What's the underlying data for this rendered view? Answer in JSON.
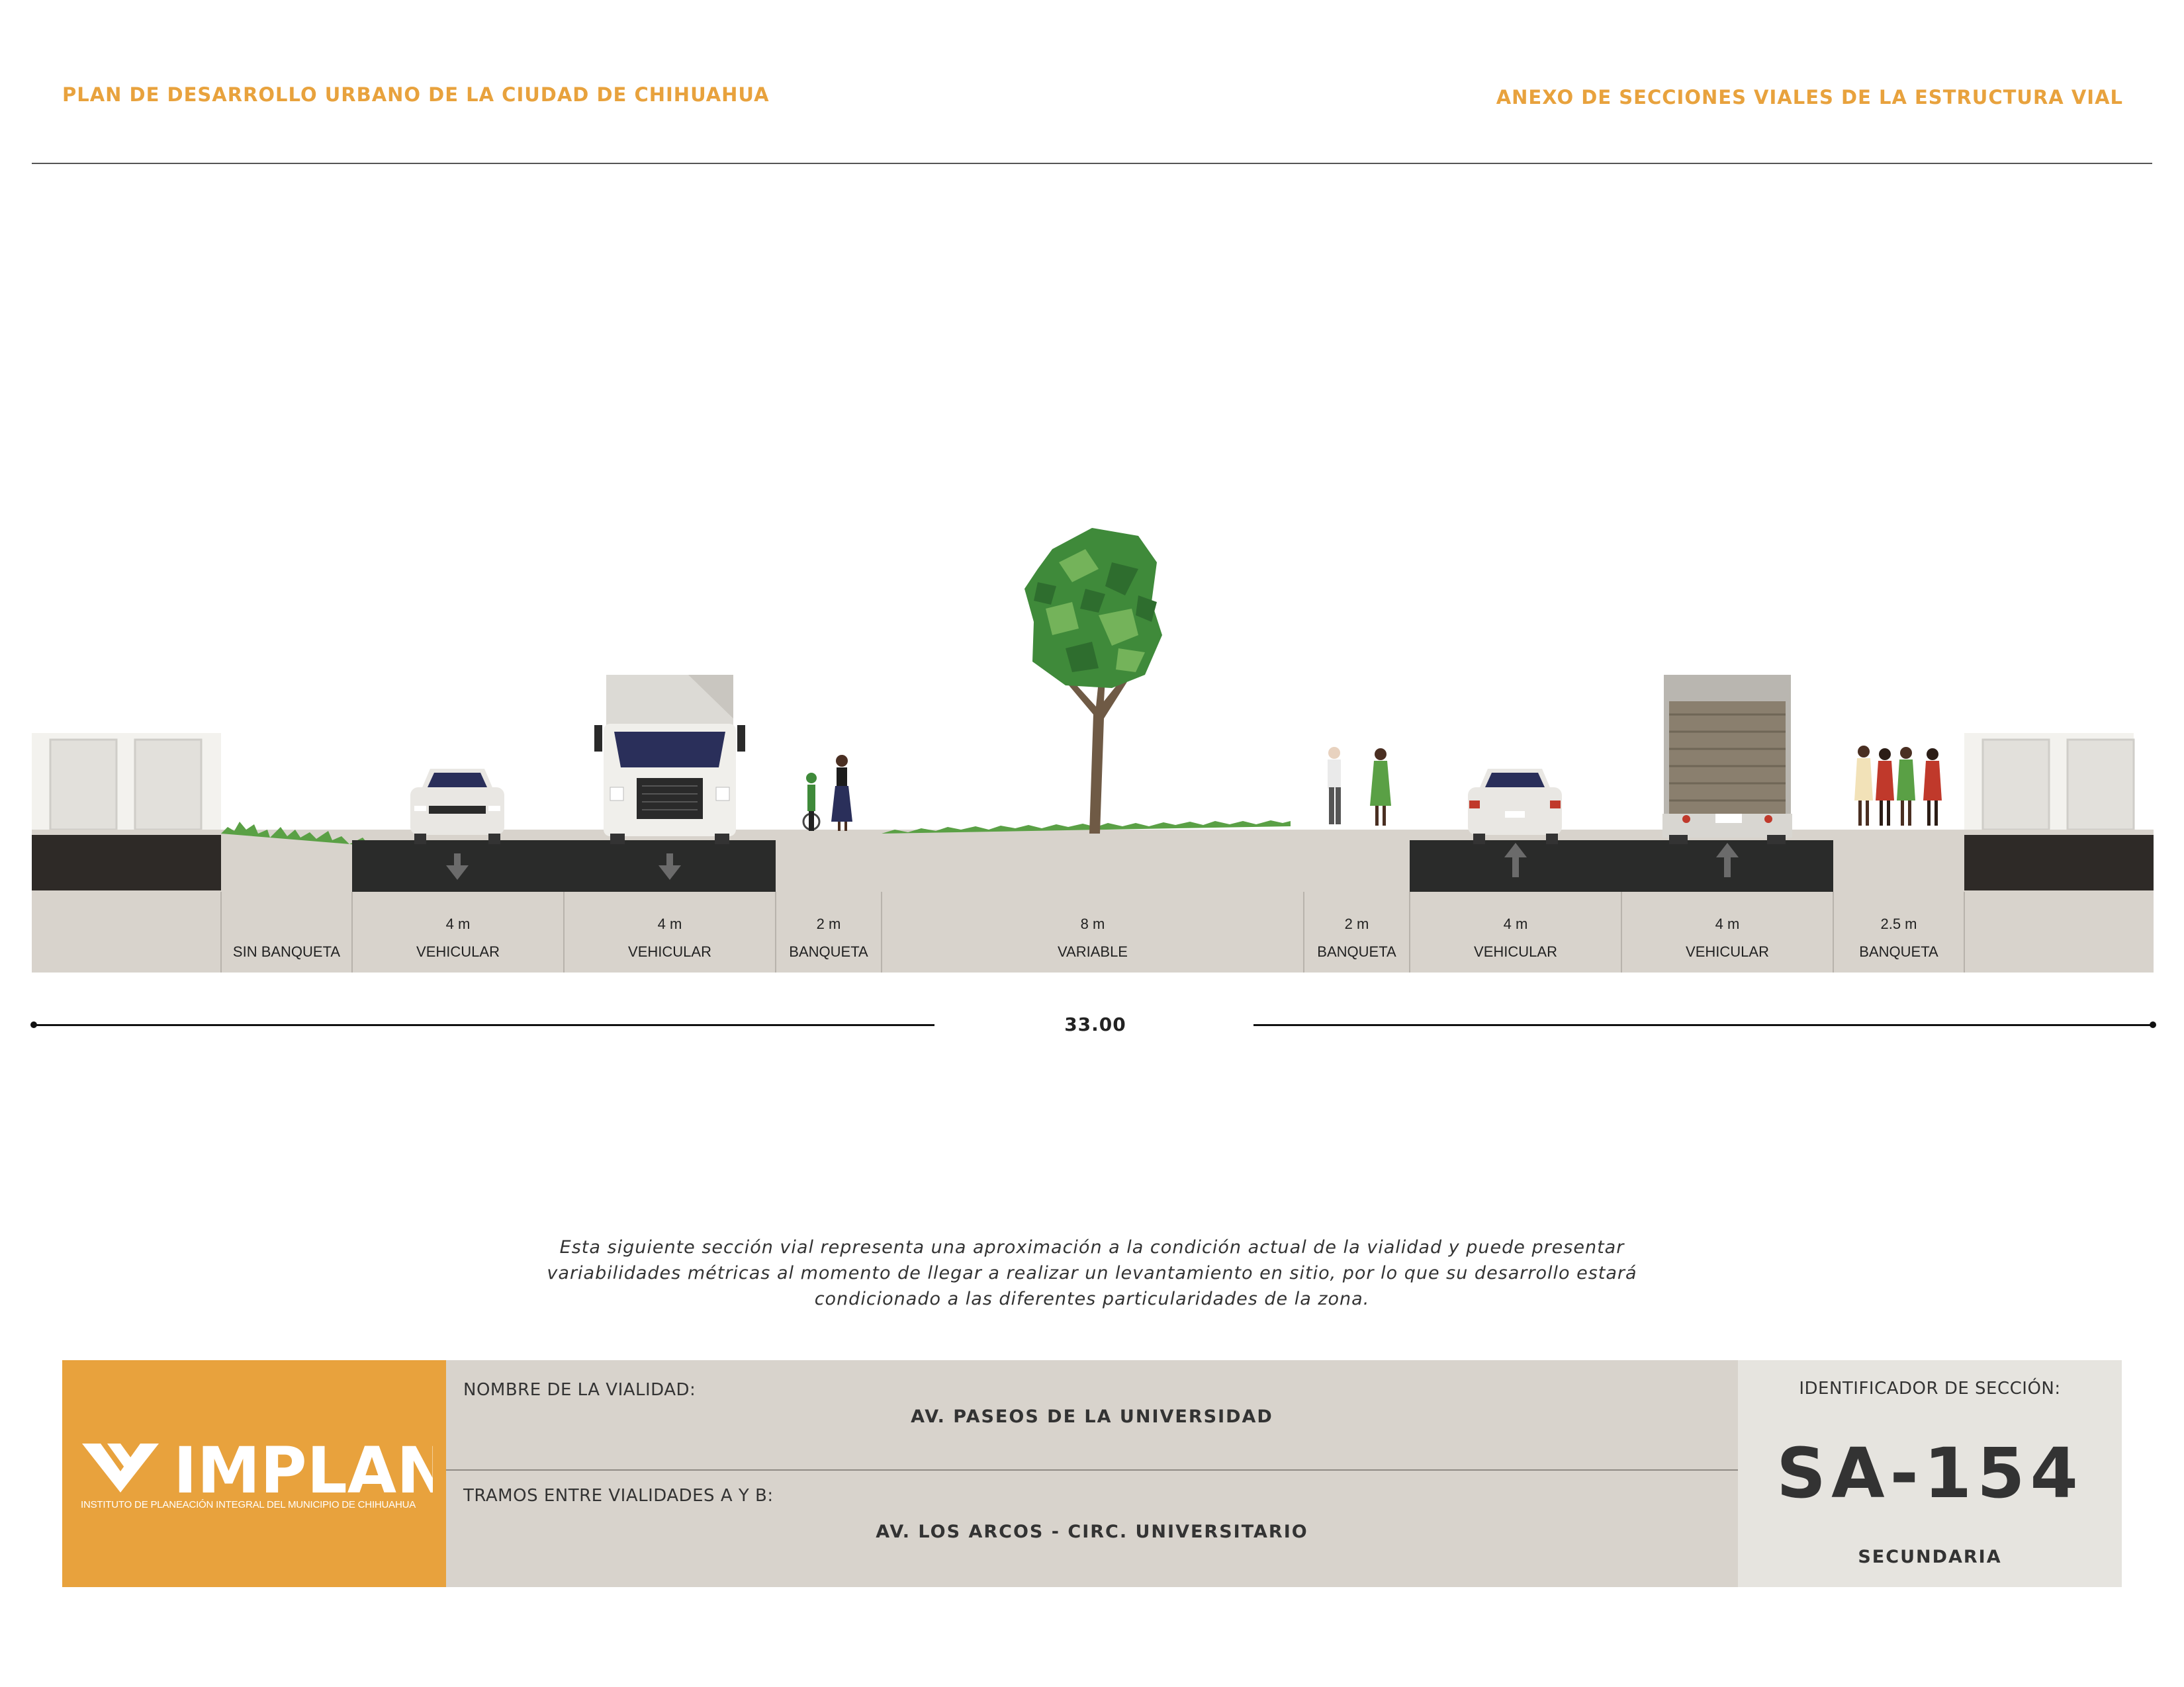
{
  "header": {
    "left_title": "PLAN DE DESARROLLO URBANO DE LA CIUDAD DE CHIHUAHUA",
    "right_title": "ANEXO DE SECCIONES VIALES DE LA ESTRUCTURA VIAL"
  },
  "section": {
    "segments": [
      {
        "width": "",
        "use": "SIN BANQUETA"
      },
      {
        "width": "4 m",
        "use": "VEHICULAR"
      },
      {
        "width": "4 m",
        "use": "VEHICULAR"
      },
      {
        "width": "2 m",
        "use": "BANQUETA"
      },
      {
        "width": "8 m",
        "use": "VARIABLE"
      },
      {
        "width": "2 m",
        "use": "BANQUETA"
      },
      {
        "width": "4 m",
        "use": "VEHICULAR"
      },
      {
        "width": "4 m",
        "use": "VEHICULAR"
      },
      {
        "width": "2.5 m",
        "use": "BANQUETA"
      }
    ],
    "total_width": "33.00",
    "lane_directions": [
      "down",
      "down",
      "up",
      "up"
    ]
  },
  "note": {
    "line1": "Esta siguiente sección vial representa una aproximación a la condición actual de la vialidad y puede presentar",
    "line2": "variabilidades métricas al momento de llegar a realizar un levantamiento en sitio, por lo que su desarrollo estará",
    "line3": "condicionado a las diferentes particularidades de la zona."
  },
  "info": {
    "logo_text": "IMPLAN",
    "logo_subtitle": "INSTITUTO DE PLANEACIÓN INTEGRAL DEL MUNICIPIO DE CHIHUAHUA",
    "road_name_label": "NOMBRE DE LA VIALIDAD:",
    "road_name": "AV. PASEOS DE LA UNIVERSIDAD",
    "stretch_label": "TRAMOS ENTRE VIALIDADES A Y B:",
    "stretch": "AV. LOS ARCOS - CIRC. UNIVERSITARIO",
    "id_label": "IDENTIFICADOR DE SECCIÓN:",
    "id_value": "SA-154",
    "classification": "SECUNDARIA"
  },
  "colors": {
    "accent": "#e8a23d",
    "asphalt": "#2a2b2a",
    "ground": "#d8d3cc",
    "planter_green": "#5aa045",
    "tree_green": "#3f8a3a"
  }
}
